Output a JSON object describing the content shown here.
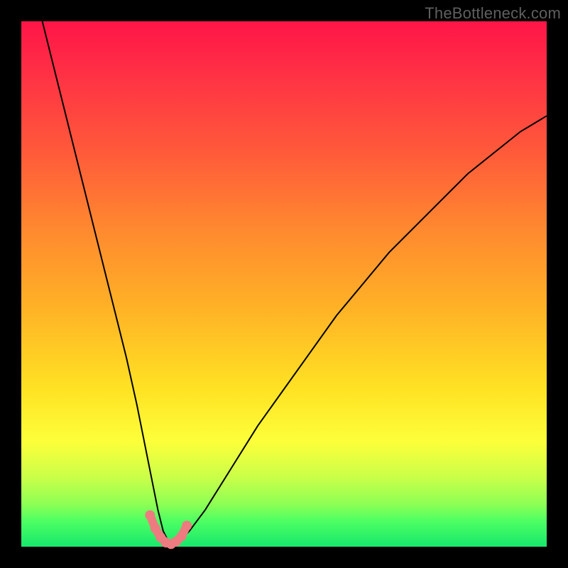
{
  "watermark": "TheBottleneck.com",
  "chart_data": {
    "type": "line",
    "title": "",
    "xlabel": "",
    "ylabel": "",
    "xlim": [
      0,
      100
    ],
    "ylim": [
      0,
      100
    ],
    "grid": false,
    "legend": false,
    "background": "rainbow-vertical-gradient",
    "description": "Single black V-shaped curve on a vertical red→yellow→green gradient. Minimum near x≈27, y≈0. Left branch exits at top-left corner; right branch exits top edge near x≈100, y≈82. Cluster of pale-red dots around the minimum.",
    "series": [
      {
        "name": "bottleneck-curve",
        "x": [
          4,
          6,
          8,
          10,
          12,
          14,
          16,
          18,
          20,
          22,
          24,
          25,
          26,
          27,
          28,
          29,
          30,
          32,
          35,
          40,
          45,
          50,
          55,
          60,
          65,
          70,
          75,
          80,
          85,
          90,
          95,
          100
        ],
        "y": [
          100,
          92,
          84,
          76,
          68,
          60,
          52,
          44,
          36,
          27,
          17,
          12,
          7,
          3,
          1,
          0.5,
          1,
          3,
          7,
          15,
          23,
          30,
          37,
          44,
          50,
          56,
          61,
          66,
          71,
          75,
          79,
          82
        ]
      }
    ],
    "highlight_points": {
      "name": "min-cluster",
      "color": "#ed7b80",
      "x": [
        24.5,
        25.5,
        26.5,
        27.5,
        28.5,
        29.5,
        30.5,
        31.5
      ],
      "y": [
        6.0,
        3.5,
        1.8,
        0.8,
        0.5,
        1.0,
        2.0,
        4.0
      ]
    }
  }
}
